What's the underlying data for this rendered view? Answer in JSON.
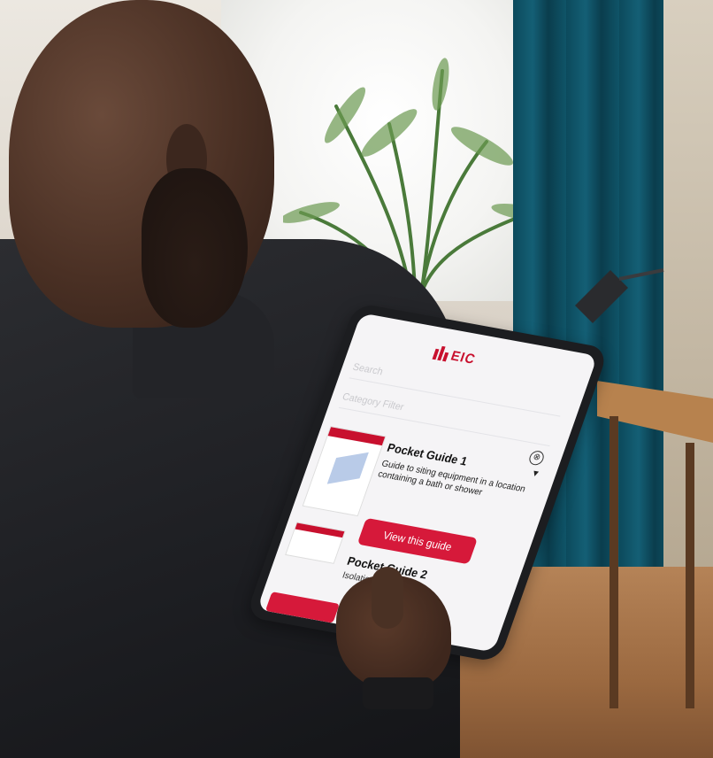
{
  "app": {
    "logo_text": "EIC"
  },
  "screen": {
    "search_placeholder": "Search",
    "filter_placeholder": "Category Filter",
    "close_symbol": "⊗",
    "guides": [
      {
        "title": "Pocket Guide 1",
        "description": "Guide to siting equipment in a location containing a bath or shower",
        "button_label": "View this guide",
        "expanded": true
      },
      {
        "title": "Pocket Guide 2",
        "description": "Isolation Proc..."
      }
    ]
  },
  "colors": {
    "brand_red": "#d6193a",
    "curtain_teal": "#0f5468",
    "cushion_yellow": "#e0a52a"
  }
}
